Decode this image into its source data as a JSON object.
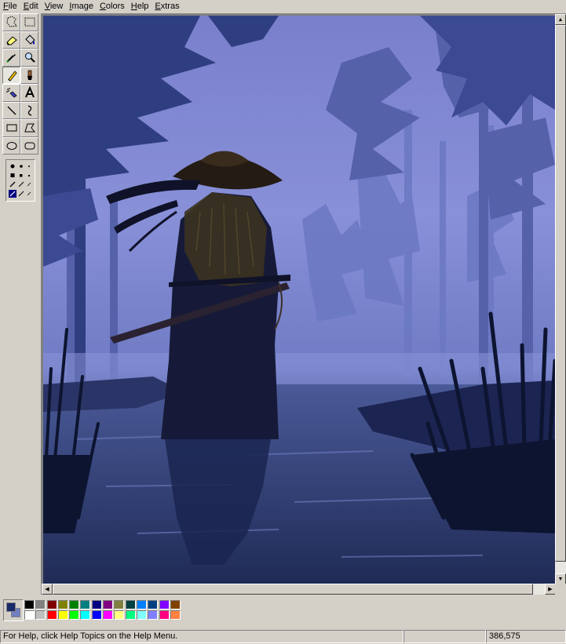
{
  "menu": [
    {
      "accel": "F",
      "rest": "ile"
    },
    {
      "accel": "E",
      "rest": "dit"
    },
    {
      "accel": "V",
      "rest": "iew"
    },
    {
      "accel": "I",
      "rest": "mage"
    },
    {
      "accel": "C",
      "rest": "olors"
    },
    {
      "accel": "H",
      "rest": "elp"
    },
    {
      "accel": "E",
      "rest": "xtras"
    }
  ],
  "tools": [
    "free-select-icon",
    "rect-select-icon",
    "eraser-icon",
    "fill-bucket-icon",
    "color-picker-icon",
    "magnifier-icon",
    "pencil-icon",
    "brush-icon",
    "airbrush-icon",
    "text-icon",
    "line-icon",
    "curve-icon",
    "rectangle-icon",
    "polygon-icon",
    "ellipse-icon",
    "rounded-rect-icon"
  ],
  "active_tool": "pencil-icon",
  "colors": {
    "foreground": "#1a2a6a",
    "background": "#6f7fc0",
    "palette": [
      "#000000",
      "#808080",
      "#800000",
      "#808000",
      "#008000",
      "#008080",
      "#000080",
      "#800080",
      "#808040",
      "#004040",
      "#0080ff",
      "#004080",
      "#8000ff",
      "#804000",
      "#ffffff",
      "#c0c0c0",
      "#ff0000",
      "#ffff00",
      "#00ff00",
      "#00ffff",
      "#0000ff",
      "#ff00ff",
      "#ffff80",
      "#00ff80",
      "#80ffff",
      "#8080ff",
      "#ff0080",
      "#ff8040"
    ]
  },
  "status": {
    "help_text": "For Help, click Help Topics on the Help Menu.",
    "size_pane": "",
    "coords": "386,575"
  }
}
